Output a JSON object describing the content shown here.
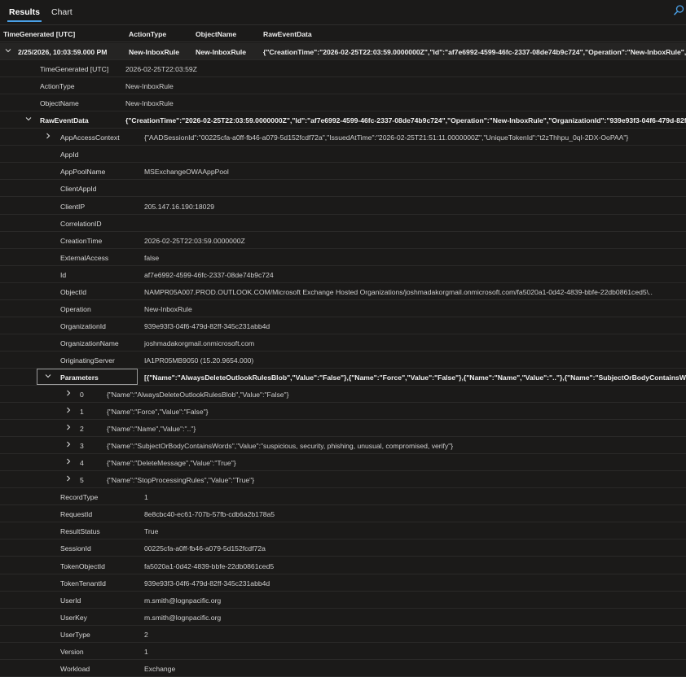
{
  "tabs": {
    "results": "Results",
    "chart": "Chart"
  },
  "columns": {
    "time_generated": "TimeGenerated [UTC]",
    "action_type": "ActionType",
    "object_name": "ObjectName",
    "raw_event_data": "RawEventData"
  },
  "main_row": {
    "time": "2/25/2026, 10:03:59.000 PM",
    "action_type": "New-InboxRule",
    "object_name": "New-InboxRule",
    "raw": "{\"CreationTime\":\"2026-02-25T22:03:59.0000000Z\",\"Id\":\"af7e6992-4599-46fc-2337-08de74b9c724\",\"Operation\":\"New-InboxRule\",\"OrganizationId\":\"939e93f3-04f6-479d-82ff-345c231abb4d\""
  },
  "detail_rows": [
    {
      "key": "TimeGenerated [UTC]",
      "value": "2026-02-25T22:03:59Z"
    },
    {
      "key": "ActionType",
      "value": "New-InboxRule"
    },
    {
      "key": "ObjectName",
      "value": "New-InboxRule"
    }
  ],
  "raw_event_data": {
    "key": "RawEventData",
    "value": "{\"CreationTime\":\"2026-02-25T22:03:59.0000000Z\",\"Id\":\"af7e6992-4599-46fc-2337-08de74b9c724\",\"Operation\":\"New-InboxRule\",\"OrganizationId\":\"939e93f3-04f6-479d-82ff-345c231abb4d\""
  },
  "app_access_context": {
    "key": "AppAccessContext",
    "value": "{\"AADSessionId\":\"00225cfa-a0ff-fb46-a079-5d152fcdf72a\",\"IssuedAtTime\":\"2026-02-25T21:51:11.0000000Z\",\"UniqueTokenId\":\"t2zThhpu_0qI-2DX-OoPAA\"}"
  },
  "fields_a": [
    {
      "key": "AppId",
      "value": ""
    },
    {
      "key": "AppPoolName",
      "value": "MSExchangeOWAAppPool"
    },
    {
      "key": "ClientAppId",
      "value": ""
    },
    {
      "key": "ClientIP",
      "value": "205.147.16.190:18029"
    },
    {
      "key": "CorrelationID",
      "value": ""
    },
    {
      "key": "CreationTime",
      "value": "2026-02-25T22:03:59.0000000Z"
    },
    {
      "key": "ExternalAccess",
      "value": "false"
    },
    {
      "key": "Id",
      "value": "af7e6992-4599-46fc-2337-08de74b9c724"
    },
    {
      "key": "ObjectId",
      "value": "NAMPR05A007.PROD.OUTLOOK.COM/Microsoft Exchange Hosted Organizations/joshmadakorgmail.onmicrosoft.com/fa5020a1-0d42-4839-bbfe-22db0861ced5\\.."
    },
    {
      "key": "Operation",
      "value": "New-InboxRule"
    },
    {
      "key": "OrganizationId",
      "value": "939e93f3-04f6-479d-82ff-345c231abb4d"
    },
    {
      "key": "OrganizationName",
      "value": "joshmadakorgmail.onmicrosoft.com"
    },
    {
      "key": "OriginatingServer",
      "value": "IA1PR05MB9050 (15.20.9654.000)"
    }
  ],
  "parameters": {
    "key": "Parameters",
    "value": "[{\"Name\":\"AlwaysDeleteOutlookRulesBlob\",\"Value\":\"False\"},{\"Name\":\"Force\",\"Value\":\"False\"},{\"Name\":\"Name\",\"Value\":\"..\"},{\"Name\":\"SubjectOrBodyContainsWor...",
    "items": [
      {
        "index": "0",
        "value": "{\"Name\":\"AlwaysDeleteOutlookRulesBlob\",\"Value\":\"False\"}"
      },
      {
        "index": "1",
        "value": "{\"Name\":\"Force\",\"Value\":\"False\"}"
      },
      {
        "index": "2",
        "value": "{\"Name\":\"Name\",\"Value\":\"..\"}"
      },
      {
        "index": "3",
        "value": "{\"Name\":\"SubjectOrBodyContainsWords\",\"Value\":\"suspicious, security, phishing, unusual, compromised, verify\"}"
      },
      {
        "index": "4",
        "value": "{\"Name\":\"DeleteMessage\",\"Value\":\"True\"}"
      },
      {
        "index": "5",
        "value": "{\"Name\":\"StopProcessingRules\",\"Value\":\"True\"}"
      }
    ]
  },
  "fields_b": [
    {
      "key": "RecordType",
      "value": "1"
    },
    {
      "key": "RequestId",
      "value": "8e8cbc40-ec61-707b-57fb-cdb6a2b178a5"
    },
    {
      "key": "ResultStatus",
      "value": "True"
    },
    {
      "key": "SessionId",
      "value": "00225cfa-a0ff-fb46-a079-5d152fcdf72a"
    },
    {
      "key": "TokenObjectId",
      "value": "fa5020a1-0d42-4839-bbfe-22db0861ced5"
    },
    {
      "key": "TokenTenantId",
      "value": "939e93f3-04f6-479d-82ff-345c231abb4d"
    },
    {
      "key": "UserId",
      "value": "m.smith@lognpacific.org"
    },
    {
      "key": "UserKey",
      "value": "m.smith@lognpacific.org"
    },
    {
      "key": "UserType",
      "value": "2"
    },
    {
      "key": "Version",
      "value": "1"
    },
    {
      "key": "Workload",
      "value": "Exchange"
    }
  ],
  "icons": {
    "search": "search-icon",
    "expanded": "chevron-down-icon",
    "collapsed": "chevron-right-icon"
  },
  "colors": {
    "accent": "#4aa0e6",
    "background": "#1b1a19"
  }
}
